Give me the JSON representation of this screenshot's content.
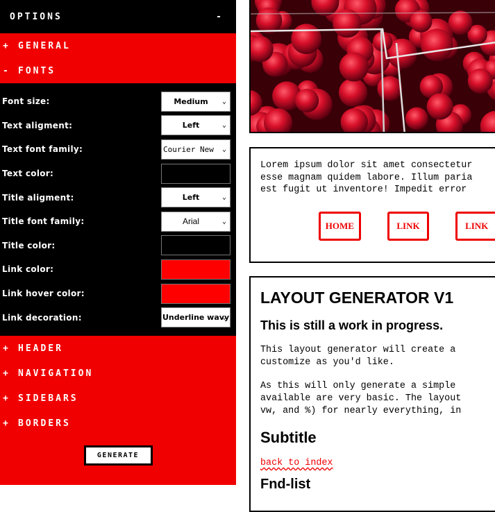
{
  "options": {
    "title": "OPTIONS",
    "toggle": "-",
    "sections_top": [
      {
        "sign": "+",
        "label": "GENERAL"
      }
    ],
    "fonts": {
      "sign": "-",
      "label": "FONTS",
      "rows": [
        {
          "label": "Font size:",
          "type": "select",
          "value": "Medium"
        },
        {
          "label": "Text aligment:",
          "type": "select",
          "value": "Left"
        },
        {
          "label": "Text font family:",
          "type": "select",
          "value": "Courier New"
        },
        {
          "label": "Text color:",
          "type": "color",
          "value": "#000000"
        },
        {
          "label": "Title aligment:",
          "type": "select",
          "value": "Left"
        },
        {
          "label": "Title font family:",
          "type": "select",
          "value": "Arial"
        },
        {
          "label": "Title color:",
          "type": "color",
          "value": "#000000"
        },
        {
          "label": "Link color:",
          "type": "color",
          "value": "#ff0000"
        },
        {
          "label": "Link hover color:",
          "type": "color",
          "value": "#ff0000"
        },
        {
          "label": "Link decoration:",
          "type": "select",
          "value": "Underline wavy"
        }
      ]
    },
    "sections_bottom": [
      {
        "sign": "+",
        "label": "HEADER"
      },
      {
        "sign": "+",
        "label": "NAVIGATION"
      },
      {
        "sign": "+",
        "label": "SIDEBARS"
      },
      {
        "sign": "+",
        "label": "BORDERS"
      }
    ],
    "generate_label": "GENERATE"
  },
  "preview": {
    "lorem_lines": [
      "Lorem ipsum dolor sit amet consectetur",
      "esse magnam quidem labore. Illum paria",
      "est fugit ut inventore! Impedit error"
    ],
    "nav": [
      "HOME",
      "LINK",
      "LINK"
    ],
    "title": "LAYOUT GENERATOR V1",
    "subtitle_wip": "This is still a work in progress.",
    "para1": "This layout generator will create a\ncustomize as you'd like.",
    "para2": "As this will only generate a simple\navailable are very basic. The layout\nvw, and %) for nearly everything, in",
    "subtitle": "Subtitle",
    "link": "back to index",
    "cut_heading": "Fnd-list"
  },
  "colors": {
    "panel_red": "#f00000",
    "panel_black": "#000000",
    "link_red": "#ee0000"
  }
}
